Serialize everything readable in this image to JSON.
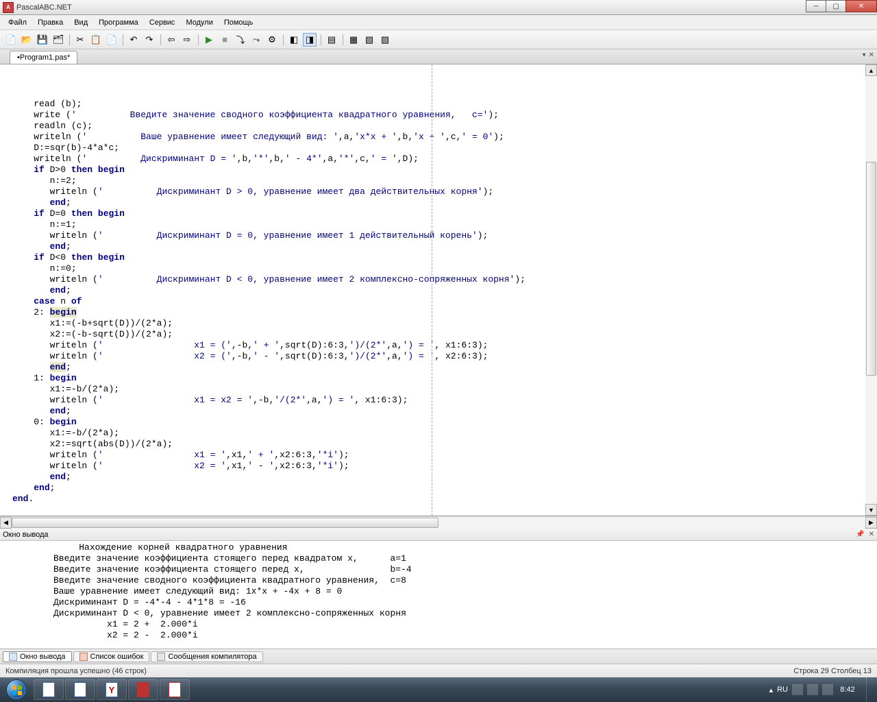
{
  "window": {
    "title": "PascalABC.NET"
  },
  "menus": [
    "Файл",
    "Правка",
    "Вид",
    "Программа",
    "Сервис",
    "Модули",
    "Помощь"
  ],
  "tab": {
    "name": "•Program1.pas*"
  },
  "code_lines": [
    {
      "indent": 4,
      "tokens": [
        {
          "t": "read (b);"
        }
      ]
    },
    {
      "indent": 4,
      "tokens": [
        {
          "t": "write ("
        },
        {
          "t": "'          Введите значение сводного коэффициента квадратного уравнения,   c='",
          "c": "str"
        },
        {
          "t": ");"
        }
      ]
    },
    {
      "indent": 4,
      "tokens": [
        {
          "t": "readln (c);"
        }
      ]
    },
    {
      "indent": 4,
      "tokens": [
        {
          "t": "writeln ("
        },
        {
          "t": "'          Ваше уравнение имеет следующий вид: '",
          "c": "str"
        },
        {
          "t": ",a,"
        },
        {
          "t": "'x*x + '",
          "c": "str"
        },
        {
          "t": ",b,"
        },
        {
          "t": "'x + '",
          "c": "str"
        },
        {
          "t": ",c,"
        },
        {
          "t": "' = 0'",
          "c": "str"
        },
        {
          "t": ");"
        }
      ]
    },
    {
      "indent": 4,
      "tokens": [
        {
          "t": "D:=sqr(b)-"
        },
        {
          "t": "4",
          "c": "num"
        },
        {
          "t": "*a*c;"
        }
      ]
    },
    {
      "indent": 4,
      "tokens": [
        {
          "t": "writeln ("
        },
        {
          "t": "'          Дискриминант D = '",
          "c": "str"
        },
        {
          "t": ",b,"
        },
        {
          "t": "'*'",
          "c": "str"
        },
        {
          "t": ",b,"
        },
        {
          "t": "' - 4*'",
          "c": "str"
        },
        {
          "t": ",a,"
        },
        {
          "t": "'*'",
          "c": "str"
        },
        {
          "t": ",c,"
        },
        {
          "t": "' = '",
          "c": "str"
        },
        {
          "t": ",D);"
        }
      ]
    },
    {
      "indent": 4,
      "tokens": [
        {
          "t": "if",
          "c": "kw"
        },
        {
          "t": " D>"
        },
        {
          "t": "0",
          "c": "num"
        },
        {
          "t": " "
        },
        {
          "t": "then",
          "c": "kw"
        },
        {
          "t": " "
        },
        {
          "t": "begin",
          "c": "kw"
        }
      ]
    },
    {
      "indent": 7,
      "tokens": [
        {
          "t": "n:="
        },
        {
          "t": "2",
          "c": "num"
        },
        {
          "t": ";"
        }
      ]
    },
    {
      "indent": 7,
      "tokens": [
        {
          "t": "writeln ("
        },
        {
          "t": "'          Дискриминант D > 0, уравнение имеет два действительных корня'",
          "c": "str"
        },
        {
          "t": ");"
        }
      ]
    },
    {
      "indent": 7,
      "tokens": [
        {
          "t": "end",
          "c": "kw"
        },
        {
          "t": ";"
        }
      ]
    },
    {
      "indent": 4,
      "tokens": [
        {
          "t": "if",
          "c": "kw"
        },
        {
          "t": " D="
        },
        {
          "t": "0",
          "c": "num"
        },
        {
          "t": " "
        },
        {
          "t": "then",
          "c": "kw"
        },
        {
          "t": " "
        },
        {
          "t": "begin",
          "c": "kw"
        }
      ]
    },
    {
      "indent": 7,
      "tokens": [
        {
          "t": "n:="
        },
        {
          "t": "1",
          "c": "num"
        },
        {
          "t": ";"
        }
      ]
    },
    {
      "indent": 7,
      "tokens": [
        {
          "t": "writeln ("
        },
        {
          "t": "'          Дискриминант D = 0, уравнение имеет 1 действительный корень'",
          "c": "str"
        },
        {
          "t": ");"
        }
      ]
    },
    {
      "indent": 7,
      "tokens": [
        {
          "t": "end",
          "c": "kw"
        },
        {
          "t": ";"
        }
      ]
    },
    {
      "indent": 4,
      "tokens": [
        {
          "t": "if",
          "c": "kw"
        },
        {
          "t": " D<"
        },
        {
          "t": "0",
          "c": "num"
        },
        {
          "t": " "
        },
        {
          "t": "then",
          "c": "kw"
        },
        {
          "t": " "
        },
        {
          "t": "begin",
          "c": "kw"
        }
      ]
    },
    {
      "indent": 7,
      "tokens": [
        {
          "t": "n:="
        },
        {
          "t": "0",
          "c": "num"
        },
        {
          "t": ";"
        }
      ]
    },
    {
      "indent": 7,
      "tokens": [
        {
          "t": "writeln ("
        },
        {
          "t": "'          Дискриминант D < 0, уравнение имеет 2 комплексно-сопряженных корня'",
          "c": "str"
        },
        {
          "t": ");"
        }
      ]
    },
    {
      "indent": 7,
      "tokens": [
        {
          "t": "end",
          "c": "kw"
        },
        {
          "t": ";"
        }
      ]
    },
    {
      "indent": 4,
      "tokens": [
        {
          "t": "case",
          "c": "kw"
        },
        {
          "t": " n "
        },
        {
          "t": "of",
          "c": "kw"
        }
      ]
    },
    {
      "indent": 4,
      "tokens": [
        {
          "t": "2",
          "c": "num"
        },
        {
          "t": ": "
        },
        {
          "t": "begin",
          "c": "kw hl"
        }
      ]
    },
    {
      "indent": 7,
      "tokens": [
        {
          "t": "x1:=(-b+sqrt(D))/("
        },
        {
          "t": "2",
          "c": "num"
        },
        {
          "t": "*a);"
        }
      ]
    },
    {
      "indent": 7,
      "tokens": [
        {
          "t": "x2:=(-b-sqrt(D))/("
        },
        {
          "t": "2",
          "c": "num"
        },
        {
          "t": "*a);"
        }
      ]
    },
    {
      "indent": 7,
      "tokens": [
        {
          "t": "writeln ("
        },
        {
          "t": "'                 x1 = ('",
          "c": "str"
        },
        {
          "t": ",-b,"
        },
        {
          "t": "' + '",
          "c": "str"
        },
        {
          "t": ",sqrt(D):"
        },
        {
          "t": "6",
          "c": "num"
        },
        {
          "t": ":"
        },
        {
          "t": "3",
          "c": "num"
        },
        {
          "t": ","
        },
        {
          "t": "')/(2*'",
          "c": "str"
        },
        {
          "t": ",a,"
        },
        {
          "t": "') = '",
          "c": "str"
        },
        {
          "t": ", x1:"
        },
        {
          "t": "6",
          "c": "num"
        },
        {
          "t": ":"
        },
        {
          "t": "3",
          "c": "num"
        },
        {
          "t": ");"
        }
      ]
    },
    {
      "indent": 7,
      "tokens": [
        {
          "t": "writeln ("
        },
        {
          "t": "'                 x2 = ('",
          "c": "str"
        },
        {
          "t": ",-b,"
        },
        {
          "t": "' - '",
          "c": "str"
        },
        {
          "t": ",sqrt(D):"
        },
        {
          "t": "6",
          "c": "num"
        },
        {
          "t": ":"
        },
        {
          "t": "3",
          "c": "num"
        },
        {
          "t": ","
        },
        {
          "t": "')/(2*'",
          "c": "str"
        },
        {
          "t": ",a,"
        },
        {
          "t": "') = '",
          "c": "str"
        },
        {
          "t": ", x2:"
        },
        {
          "t": "6",
          "c": "num"
        },
        {
          "t": ":"
        },
        {
          "t": "3",
          "c": "num"
        },
        {
          "t": ");"
        }
      ]
    },
    {
      "indent": 7,
      "tokens": [
        {
          "t": "end",
          "c": "kw hl"
        },
        {
          "t": ";"
        }
      ]
    },
    {
      "indent": 4,
      "tokens": [
        {
          "t": "1",
          "c": "num"
        },
        {
          "t": ": "
        },
        {
          "t": "begin",
          "c": "kw"
        }
      ]
    },
    {
      "indent": 7,
      "tokens": [
        {
          "t": "x1:=-b/("
        },
        {
          "t": "2",
          "c": "num"
        },
        {
          "t": "*a);"
        }
      ]
    },
    {
      "indent": 7,
      "tokens": [
        {
          "t": "writeln ("
        },
        {
          "t": "'                 x1 = x2 = '",
          "c": "str"
        },
        {
          "t": ",-b,"
        },
        {
          "t": "'/(2*'",
          "c": "str"
        },
        {
          "t": ",a,"
        },
        {
          "t": "') = '",
          "c": "str"
        },
        {
          "t": ", x1:"
        },
        {
          "t": "6",
          "c": "num"
        },
        {
          "t": ":"
        },
        {
          "t": "3",
          "c": "num"
        },
        {
          "t": ");"
        }
      ]
    },
    {
      "indent": 7,
      "tokens": [
        {
          "t": "end",
          "c": "kw"
        },
        {
          "t": ";"
        }
      ]
    },
    {
      "indent": 4,
      "tokens": [
        {
          "t": "0",
          "c": "num"
        },
        {
          "t": ": "
        },
        {
          "t": "begin",
          "c": "kw"
        }
      ]
    },
    {
      "indent": 7,
      "tokens": [
        {
          "t": "x1:=-b/("
        },
        {
          "t": "2",
          "c": "num"
        },
        {
          "t": "*a);"
        }
      ]
    },
    {
      "indent": 7,
      "tokens": [
        {
          "t": "x2:=sqrt(abs(D))/("
        },
        {
          "t": "2",
          "c": "num"
        },
        {
          "t": "*a);"
        }
      ]
    },
    {
      "indent": 7,
      "tokens": [
        {
          "t": "writeln ("
        },
        {
          "t": "'                 x1 = '",
          "c": "str"
        },
        {
          "t": ",x1,"
        },
        {
          "t": "' + '",
          "c": "str"
        },
        {
          "t": ",x2:"
        },
        {
          "t": "6",
          "c": "num"
        },
        {
          "t": ":"
        },
        {
          "t": "3",
          "c": "num"
        },
        {
          "t": ","
        },
        {
          "t": "'*i'",
          "c": "str"
        },
        {
          "t": ");"
        }
      ]
    },
    {
      "indent": 7,
      "tokens": [
        {
          "t": "writeln ("
        },
        {
          "t": "'                 x2 = '",
          "c": "str"
        },
        {
          "t": ",x1,"
        },
        {
          "t": "' - '",
          "c": "str"
        },
        {
          "t": ",x2:"
        },
        {
          "t": "6",
          "c": "num"
        },
        {
          "t": ":"
        },
        {
          "t": "3",
          "c": "num"
        },
        {
          "t": ","
        },
        {
          "t": "'*i'",
          "c": "str"
        },
        {
          "t": ");"
        }
      ]
    },
    {
      "indent": 7,
      "tokens": [
        {
          "t": "end",
          "c": "kw"
        },
        {
          "t": ";"
        }
      ]
    },
    {
      "indent": 4,
      "tokens": [
        {
          "t": "end",
          "c": "kw"
        },
        {
          "t": ";"
        }
      ]
    },
    {
      "indent": 0,
      "tokens": [
        {
          "t": "end",
          "c": "kw"
        },
        {
          "t": "."
        }
      ]
    }
  ],
  "output": {
    "title": "Окно вывода",
    "lines": [
      "              Нахождение корней квадратного уравнения",
      "Введите значение коэффициента стоящего перед квадратом x,      a=1",
      "Введите значение коэффициента стоящего перед x,                b=-4",
      "Введите значение сводного коэффициента квадратного уравнения,  c=8",
      "Ваше уравнение имеет следующий вид: 1x*x + -4x + 8 = 0",
      "Дискриминант D = -4*-4 - 4*1*8 = -16",
      "Дискриминант D < 0, уравнение имеет 2 комплексно-сопряженных корня",
      "          x1 = 2 +  2.000*i",
      "          x2 = 2 -  2.000*i"
    ]
  },
  "bottom_tabs": {
    "output": "Окно вывода",
    "errors": "Список ошибок",
    "messages": "Сообщения компилятора"
  },
  "status": {
    "left": "Компиляция прошла успешно (46 строк)",
    "right": "Строка  29  Столбец  13"
  },
  "tray": {
    "lang": "RU",
    "time": "8:42"
  }
}
